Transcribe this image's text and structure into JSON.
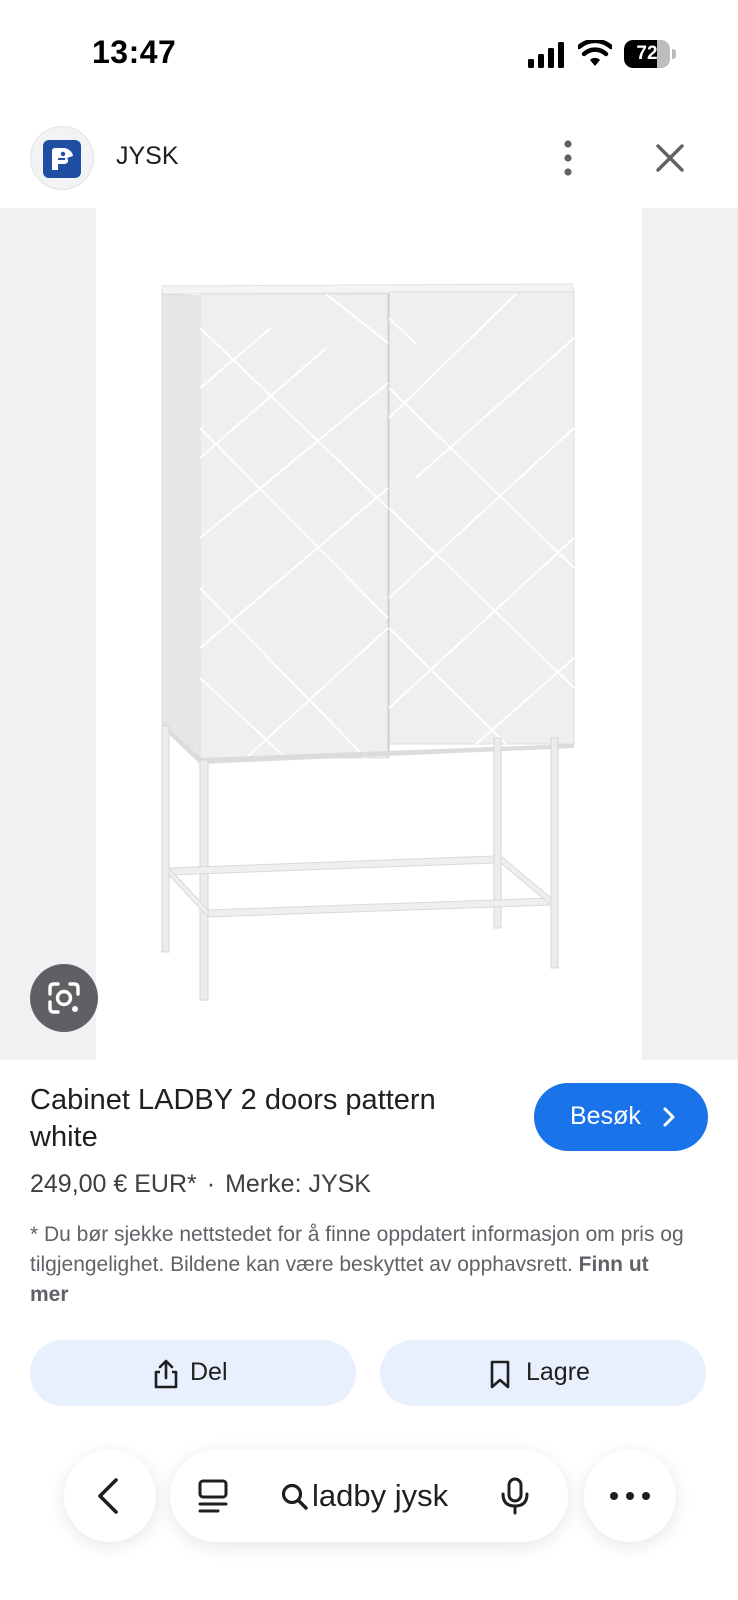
{
  "status_bar": {
    "time": "13:47",
    "battery_percent": "72",
    "battery_level": 0.72,
    "icons": [
      "signal-icon",
      "wifi-icon",
      "battery-icon"
    ]
  },
  "source": {
    "name": "JYSK",
    "icons": [
      "jysk-logo-icon",
      "more-vert-icon",
      "close-icon"
    ]
  },
  "image": {
    "icons": [
      "google-lens-icon"
    ]
  },
  "product": {
    "title": "Cabinet LADBY 2 doors pattern white",
    "visit_label": "Besøk",
    "price": "249,00 € EUR*",
    "separator": "·",
    "brand": "Merke: JYSK",
    "disclaimer": "* Du bør sjekke nettstedet for å finne oppdatert informasjon om pris og tilgjengelighet. Bildene kan være beskyttet av opphavsrett.",
    "learn_more": "Finn ut mer"
  },
  "actions": {
    "share_label": "Del",
    "save_label": "Lagre"
  },
  "bottom_bar": {
    "search_query": "ladby jysk",
    "icons": [
      "back-icon",
      "tabs-icon",
      "search-icon",
      "mic-icon",
      "more-horiz-icon"
    ]
  },
  "colors": {
    "accent": "#1a73e8",
    "action_bg": "#e8effd",
    "image_bg": "#eff1f3",
    "brand_blue": "#1f4ea3"
  }
}
